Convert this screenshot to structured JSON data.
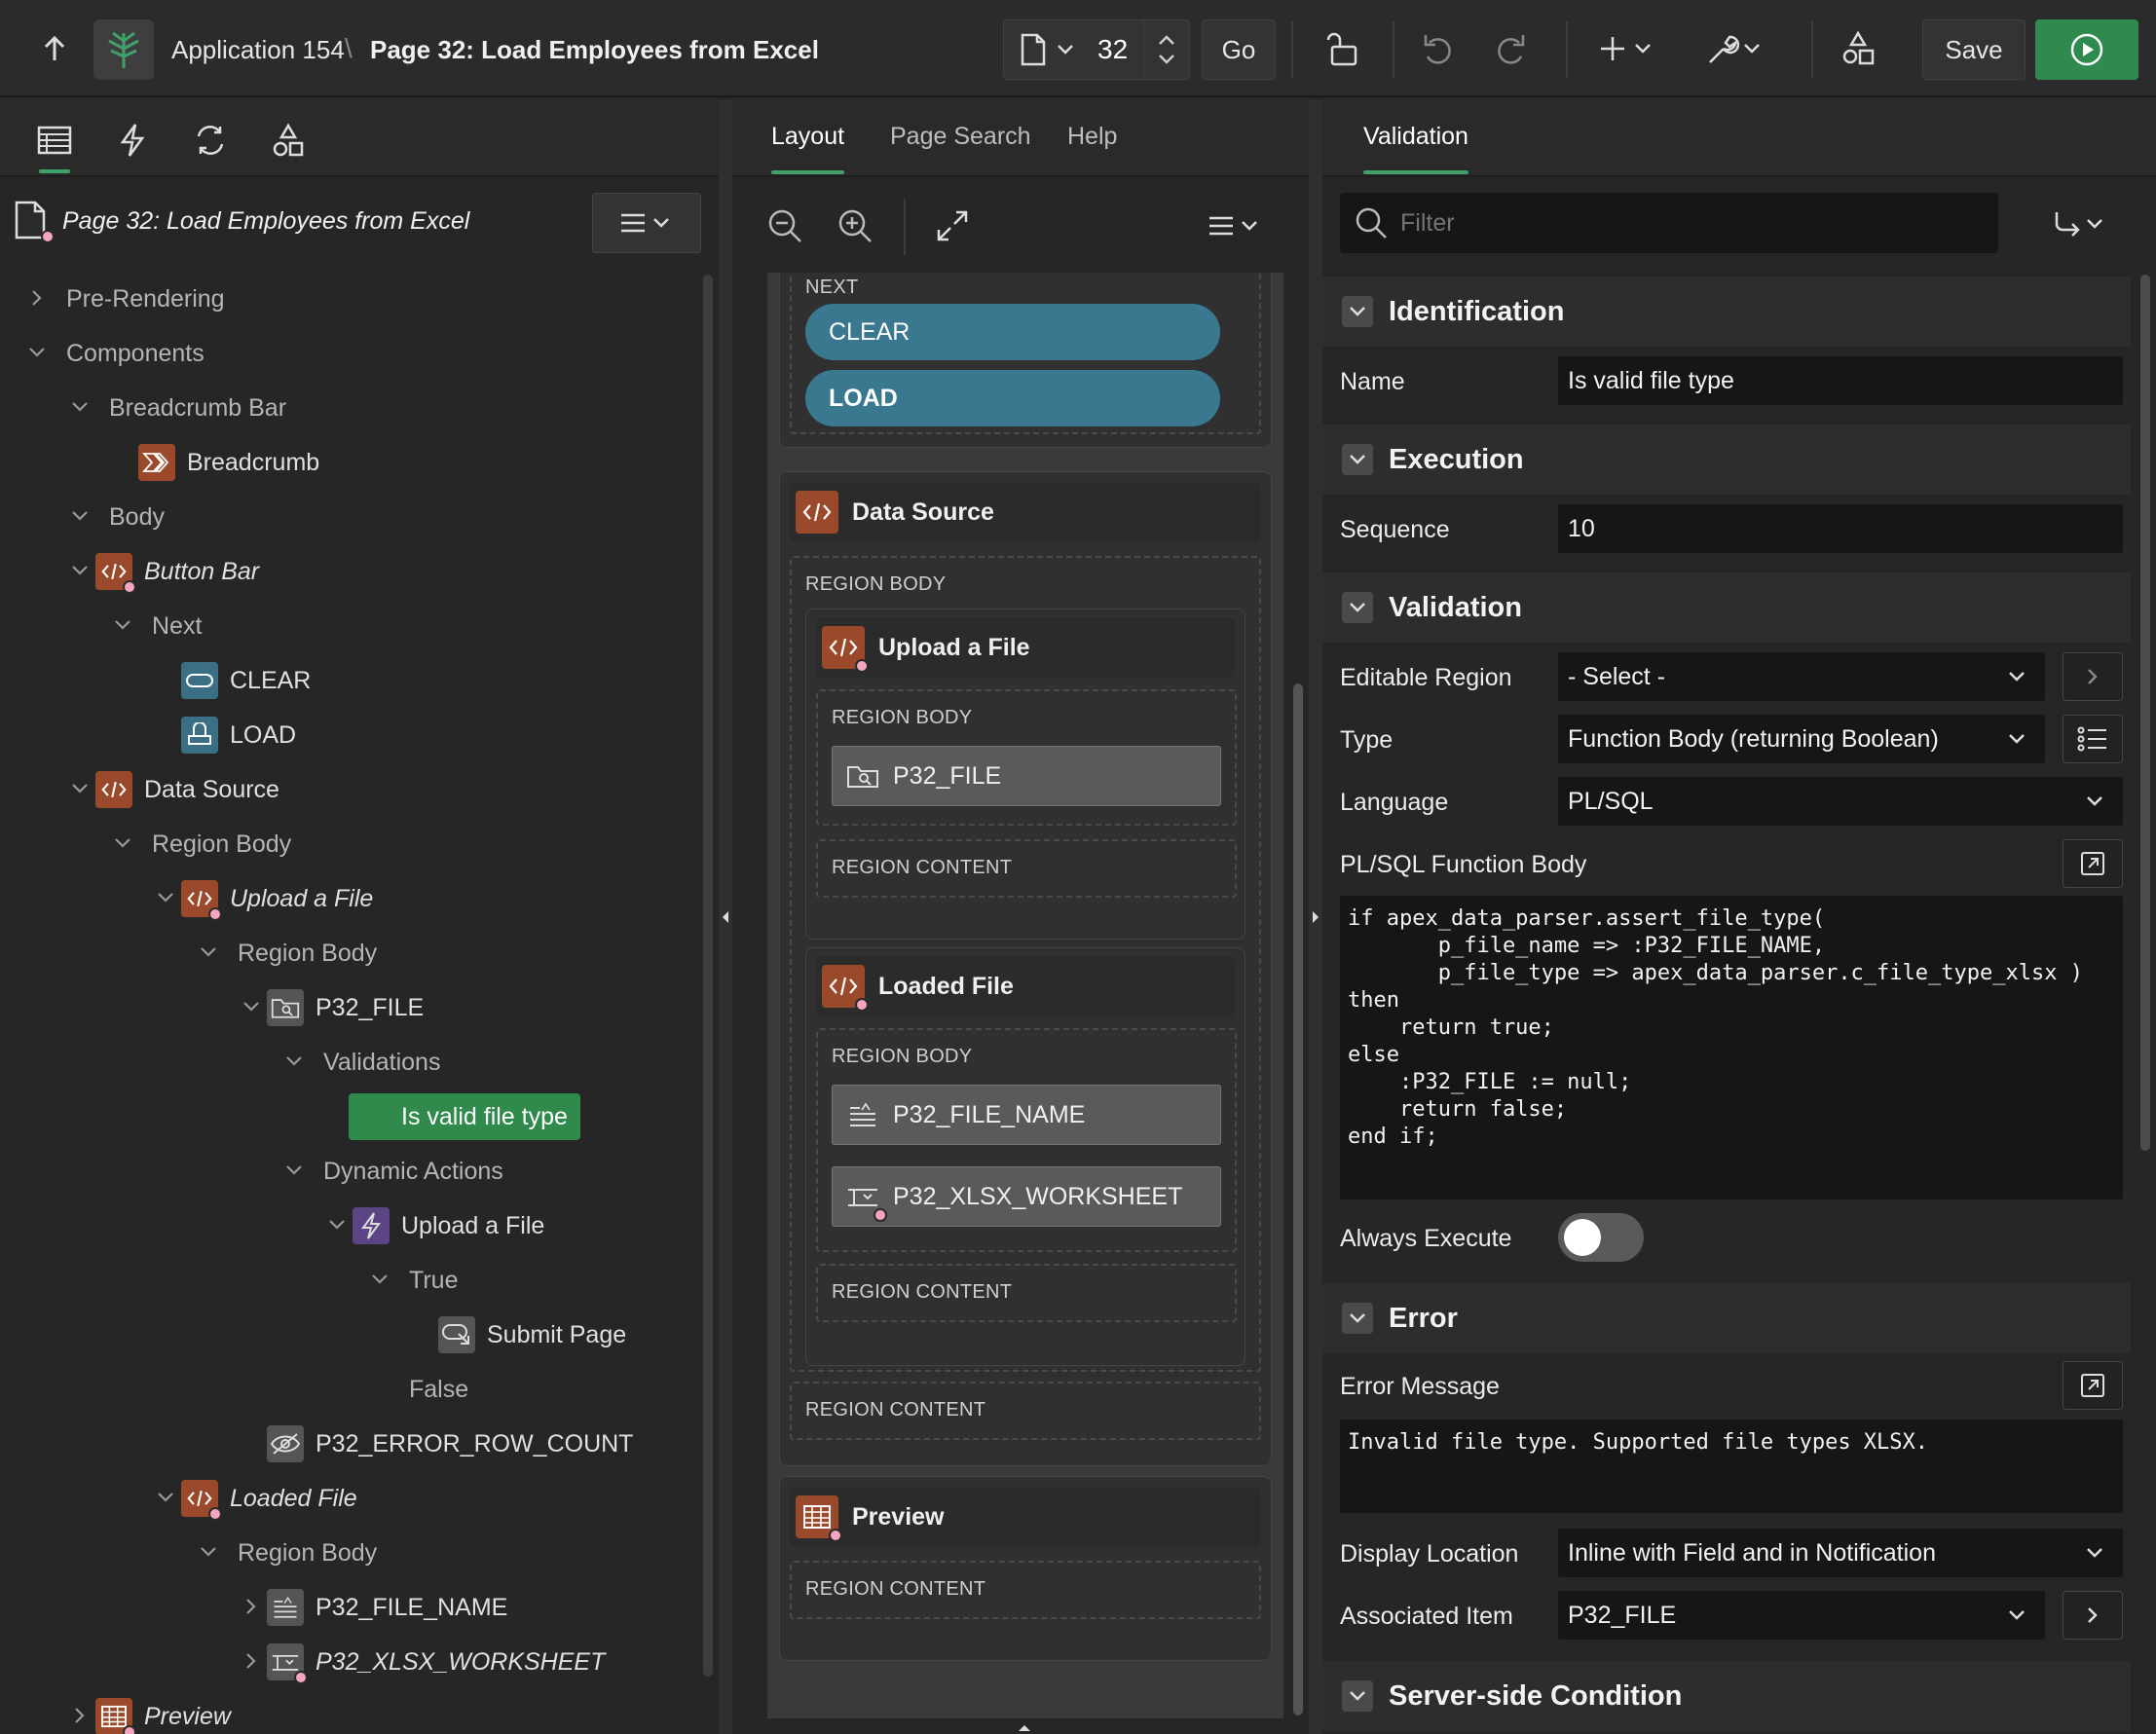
{
  "app": {
    "name": "Application 154",
    "separator": "\\",
    "page_title": "Page 32: Load Employees from Excel",
    "page_number": "32",
    "go_label": "Go",
    "save_label": "Save"
  },
  "left_panel": {
    "root_title": "Page 32: Load Employees from Excel",
    "tree": [
      {
        "label": "Pre-Rendering"
      },
      {
        "label": "Components"
      },
      {
        "label": "Breadcrumb Bar"
      },
      {
        "label": "Breadcrumb"
      },
      {
        "label": "Body"
      },
      {
        "label": "Button Bar"
      },
      {
        "label": "Next"
      },
      {
        "label": "CLEAR"
      },
      {
        "label": "LOAD"
      },
      {
        "label": "Data Source"
      },
      {
        "label": "Region Body"
      },
      {
        "label": "Upload a File"
      },
      {
        "label": "Region Body"
      },
      {
        "label": "P32_FILE"
      },
      {
        "label": "Validations"
      },
      {
        "label": "Is valid file type"
      },
      {
        "label": "Dynamic Actions"
      },
      {
        "label": "Upload a File"
      },
      {
        "label": "True"
      },
      {
        "label": "Submit Page"
      },
      {
        "label": "False"
      },
      {
        "label": "P32_ERROR_ROW_COUNT"
      },
      {
        "label": "Loaded File"
      },
      {
        "label": "Region Body"
      },
      {
        "label": "P32_FILE_NAME"
      },
      {
        "label": "P32_XLSX_WORKSHEET"
      },
      {
        "label": "Preview"
      }
    ]
  },
  "center_panel": {
    "tabs": [
      "Layout",
      "Page Search",
      "Help"
    ],
    "next_label": "NEXT",
    "clear_button": "CLEAR",
    "load_button": "LOAD",
    "data_source": "Data Source",
    "region_body": "REGION BODY",
    "region_content": "REGION CONTENT",
    "upload_region": "Upload a File",
    "p32_file": "P32_FILE",
    "loaded_region": "Loaded File",
    "p32_file_name": "P32_FILE_NAME",
    "p32_worksheet": "P32_XLSX_WORKSHEET",
    "preview_region": "Preview"
  },
  "right_panel": {
    "tab": "Validation",
    "filter_placeholder": "Filter",
    "sections": {
      "identification": "Identification",
      "execution": "Execution",
      "validation": "Validation",
      "error": "Error",
      "server_side": "Server-side Condition"
    },
    "props": {
      "name_label": "Name",
      "name_value": "Is valid file type",
      "sequence_label": "Sequence",
      "sequence_value": "10",
      "editable_region_label": "Editable Region",
      "editable_region_value": "- Select -",
      "type_label": "Type",
      "type_value": "Function Body (returning Boolean)",
      "language_label": "Language",
      "language_value": "PL/SQL",
      "plsql_label": "PL/SQL Function Body",
      "plsql_code": "if apex_data_parser.assert_file_type(\n       p_file_name => :P32_FILE_NAME,\n       p_file_type => apex_data_parser.c_file_type_xlsx )\nthen\n    return true;\nelse\n    :P32_FILE := null;\n    return false;\nend if;",
      "always_execute_label": "Always Execute",
      "always_execute_on": false,
      "error_message_label": "Error Message",
      "error_message_value": "Invalid file type. Supported file types XLSX.",
      "display_location_label": "Display Location",
      "display_location_value": "Inline with Field and in Notification",
      "associated_item_label": "Associated Item",
      "associated_item_value": "P32_FILE"
    }
  },
  "colors": {
    "accent_green": "#3fa06a",
    "run_button": "#2e8a4f",
    "selected_node": "#2f8a4c",
    "region_icon": "#9a4a2b",
    "button_pill": "#3a7890"
  }
}
